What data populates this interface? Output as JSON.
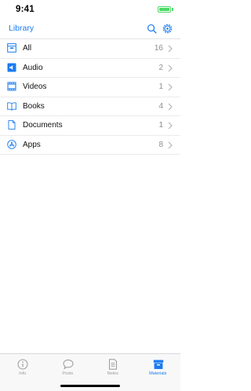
{
  "status_bar": {
    "time": "9:41"
  },
  "nav": {
    "title": "Library",
    "search_icon": "search-icon",
    "settings_icon": "gear-icon"
  },
  "colors": {
    "accent": "#1a7bf2",
    "inactive": "#9b9b9f",
    "battery": "#4cd964"
  },
  "library_items": [
    {
      "label": "All",
      "count": "16",
      "icon": "archive-box-icon"
    },
    {
      "label": "Audio",
      "count": "2",
      "icon": "speaker-icon"
    },
    {
      "label": "Videos",
      "count": "1",
      "icon": "film-strip-icon"
    },
    {
      "label": "Books",
      "count": "4",
      "icon": "open-book-icon"
    },
    {
      "label": "Documents",
      "count": "1",
      "icon": "document-icon"
    },
    {
      "label": "Apps",
      "count": "8",
      "icon": "app-store-icon"
    }
  ],
  "tabs": [
    {
      "label": "Info",
      "icon": "info-icon",
      "active": false
    },
    {
      "label": "Posts",
      "icon": "speech-bubble-icon",
      "active": false
    },
    {
      "label": "Notes",
      "icon": "notes-icon",
      "active": false
    },
    {
      "label": "Materials",
      "icon": "materials-box-icon",
      "active": true
    }
  ]
}
